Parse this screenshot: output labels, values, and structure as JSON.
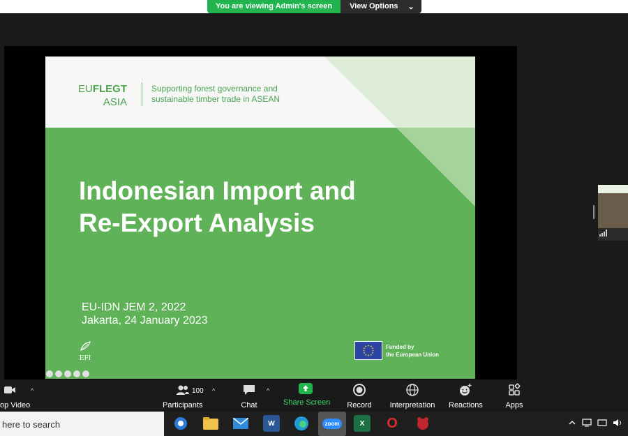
{
  "sharing": {
    "banner_label": "You are viewing Admin's screen",
    "view_options_label": "View Options",
    "view_options_caret": "⌄"
  },
  "slide": {
    "logo_eu": "EU",
    "logo_flegt": "FLEGT",
    "logo_asia": "ASIA",
    "tagline_line1": "Supporting forest governance and",
    "tagline_line2": "sustainable timber trade in ASEAN",
    "title_line1": "Indonesian Import and",
    "title_line2": "Re-Export Analysis",
    "subtitle_line1": "EU-IDN JEM 2, 2022",
    "subtitle_line2": "Jakarta, 24 January 2023",
    "efi_label": "EFI",
    "funded_line1": "Funded by",
    "funded_line2": "the European Union",
    "colors": {
      "green": "#5fb257",
      "header": "#f7f7f7",
      "logo_green": "#4aa24f"
    }
  },
  "toolbar": {
    "stop_video": "op Video",
    "participants": "Participants",
    "participant_count": "100",
    "chat": "Chat",
    "share_screen": "Share Screen",
    "record": "Record",
    "interpretation": "Interpretation",
    "reactions": "Reactions",
    "apps": "Apps",
    "caret": "^"
  },
  "taskbar": {
    "search_text": "here to search",
    "apps": [
      "outlook",
      "file-explorer",
      "mail",
      "word",
      "edge",
      "zoom",
      "excel",
      "opera",
      "app-64"
    ],
    "zoom_label": "zoom",
    "opera_label": "O",
    "word_label": "W",
    "excel_label": "X"
  }
}
